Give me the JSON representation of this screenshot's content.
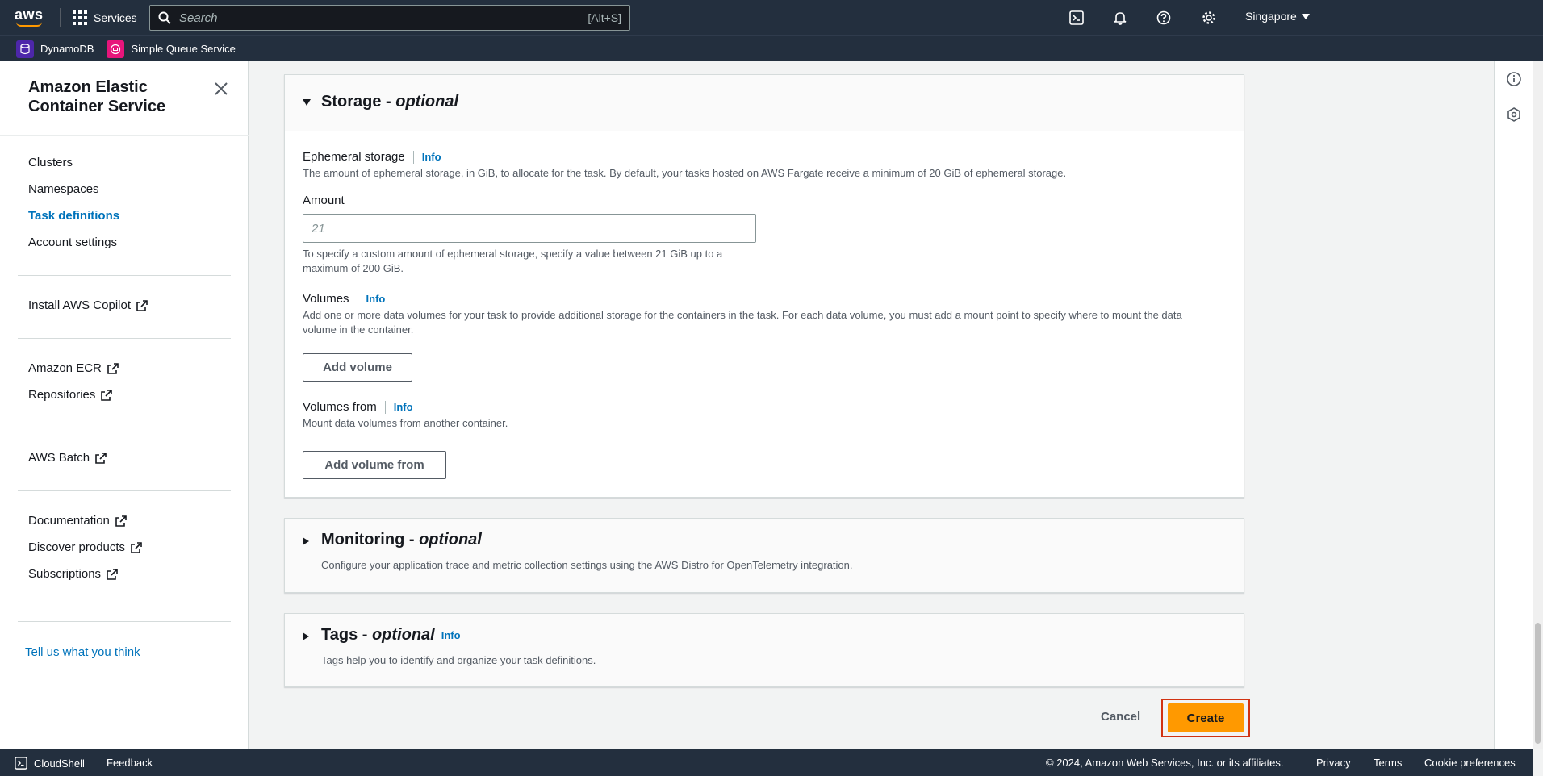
{
  "topbar": {
    "logo_text": "aws",
    "services_label": "Services",
    "search_placeholder": "Search",
    "search_shortcut": "[Alt+S]",
    "region_label": "Singapore"
  },
  "favorites": [
    {
      "label": "DynamoDB",
      "color": "#4d27aa"
    },
    {
      "label": "Simple Queue Service",
      "color": "#e7157b"
    }
  ],
  "sidebar": {
    "title": "Amazon Elastic Container Service",
    "items": [
      {
        "label": "Clusters",
        "active": false
      },
      {
        "label": "Namespaces",
        "active": false
      },
      {
        "label": "Task definitions",
        "active": true
      },
      {
        "label": "Account settings",
        "active": false
      }
    ],
    "external": {
      "copilot": "Install AWS Copilot",
      "ecr": "Amazon ECR",
      "repositories": "Repositories",
      "batch": "AWS Batch",
      "documentation": "Documentation",
      "discover": "Discover products",
      "subscriptions": "Subscriptions"
    },
    "feedback": "Tell us what you think"
  },
  "storage": {
    "title": "Storage - ",
    "title_optional": "optional",
    "ephemeral_label": "Ephemeral storage",
    "info": "Info",
    "ephemeral_desc": "The amount of ephemeral storage, in GiB, to allocate for the task. By default, your tasks hosted on AWS Fargate receive a minimum of 20 GiB of ephemeral storage.",
    "amount_label": "Amount",
    "amount_placeholder": "21",
    "amount_hint_1": "To specify a custom amount of ephemeral storage, specify a value between 21 GiB up to a",
    "amount_hint_2": "maximum of 200 GiB.",
    "volumes_label": "Volumes",
    "volumes_desc_1": "Add one or more data volumes for your task to provide additional storage for the containers in the task. For each data volume, you must add a mount point to specify where to mount the data",
    "volumes_desc_2": "volume in the container.",
    "add_volume": "Add volume",
    "volumes_from_label": "Volumes from",
    "volumes_from_desc": "Mount data volumes from another container.",
    "add_volume_from": "Add volume from"
  },
  "monitoring": {
    "title": "Monitoring - ",
    "title_optional": "optional",
    "desc": "Configure your application trace and metric collection settings using the AWS Distro for OpenTelemetry integration."
  },
  "tags": {
    "title": "Tags - ",
    "title_optional": "optional",
    "info": "Info",
    "desc": "Tags help you to identify and organize your task definitions."
  },
  "actions": {
    "cancel": "Cancel",
    "create": "Create"
  },
  "footer": {
    "cloudshell": "CloudShell",
    "feedback": "Feedback",
    "copyright": "© 2024, Amazon Web Services, Inc. or its affiliates.",
    "privacy": "Privacy",
    "terms": "Terms",
    "cookies": "Cookie preferences"
  },
  "colors": {
    "nav_bg": "#232f3e",
    "accent_link": "#0073bb",
    "primary_button": "#ff9900",
    "highlight_border": "#d13212"
  }
}
